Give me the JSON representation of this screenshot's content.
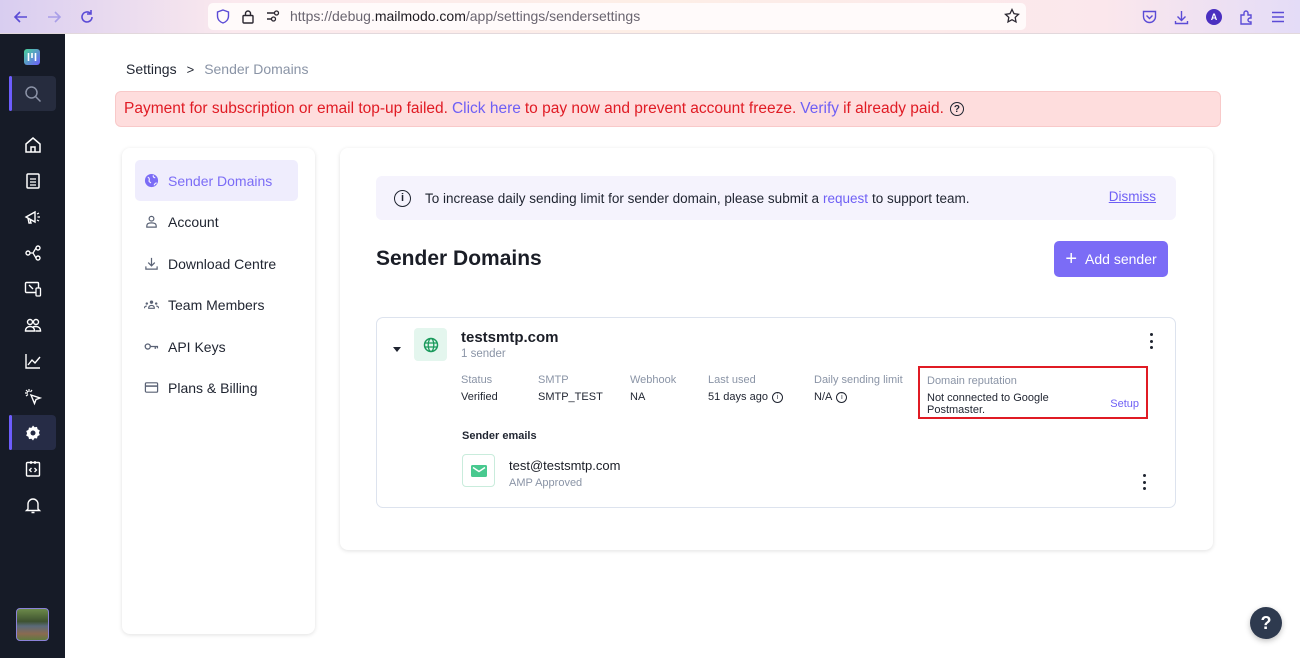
{
  "browser": {
    "url_prefix": "https://debug.",
    "url_domain": "mailmodo.com",
    "url_path": "/app/settings/sendersettings",
    "profile_initial": "A"
  },
  "sidebar": {
    "items": [
      {
        "name": "search",
        "icon": "search-icon"
      },
      {
        "name": "home",
        "icon": "home-icon"
      },
      {
        "name": "templates",
        "icon": "template-icon"
      },
      {
        "name": "campaigns",
        "icon": "megaphone-icon"
      },
      {
        "name": "journeys",
        "icon": "flow-icon"
      },
      {
        "name": "forms",
        "icon": "forms-icon"
      },
      {
        "name": "contacts",
        "icon": "contacts-icon"
      },
      {
        "name": "analytics",
        "icon": "chart-icon"
      },
      {
        "name": "tracking",
        "icon": "cursor-click-icon"
      },
      {
        "name": "settings",
        "icon": "gear-icon",
        "active": true
      },
      {
        "name": "developer",
        "icon": "code-icon"
      },
      {
        "name": "notifications",
        "icon": "bell-icon"
      }
    ]
  },
  "breadcrumb": {
    "root": "Settings",
    "separator": ">",
    "current": "Sender Domains"
  },
  "alert": {
    "text1": "Payment for subscription or email top-up failed.",
    "link1": "Click here",
    "text2": "to pay now and prevent account freeze.",
    "link2": "Verify",
    "text3": "if already paid.",
    "help": "?"
  },
  "settings_nav": {
    "items": [
      {
        "label": "Sender Domains",
        "icon": "globe-icon",
        "active": true
      },
      {
        "label": "Account",
        "icon": "user-icon"
      },
      {
        "label": "Download Centre",
        "icon": "download-icon"
      },
      {
        "label": "Team Members",
        "icon": "team-icon"
      },
      {
        "label": "API Keys",
        "icon": "key-icon"
      },
      {
        "label": "Plans & Billing",
        "icon": "card-icon"
      }
    ]
  },
  "info_banner": {
    "text1": "To increase daily sending limit for sender domain, please submit a",
    "link": "request",
    "text2": "to support team.",
    "dismiss": "Dismiss"
  },
  "main": {
    "title": "Sender Domains",
    "add_button": "Add sender"
  },
  "domain": {
    "name": "testsmtp.com",
    "sender_count": "1 sender",
    "fields": [
      {
        "label": "Status",
        "value": "Verified"
      },
      {
        "label": "SMTP",
        "value": "SMTP_TEST"
      },
      {
        "label": "Webhook",
        "value": "NA"
      },
      {
        "label": "Last used",
        "value": "51 days ago"
      },
      {
        "label": "Daily sending limit",
        "value": "N/A"
      }
    ],
    "reputation": {
      "label": "Domain reputation",
      "value": "Not connected to Google Postmaster.",
      "link": "Setup"
    },
    "sender_emails_title": "Sender emails",
    "emails": [
      {
        "address": "test@testsmtp.com",
        "status": "AMP Approved"
      }
    ]
  },
  "help_button": "?",
  "colors": {
    "accent": "#7b6cf6",
    "alert_red": "#e01b24",
    "alert_bg": "#fedddd",
    "sidebar_bg": "#161b27",
    "success_green": "#48c98f"
  }
}
